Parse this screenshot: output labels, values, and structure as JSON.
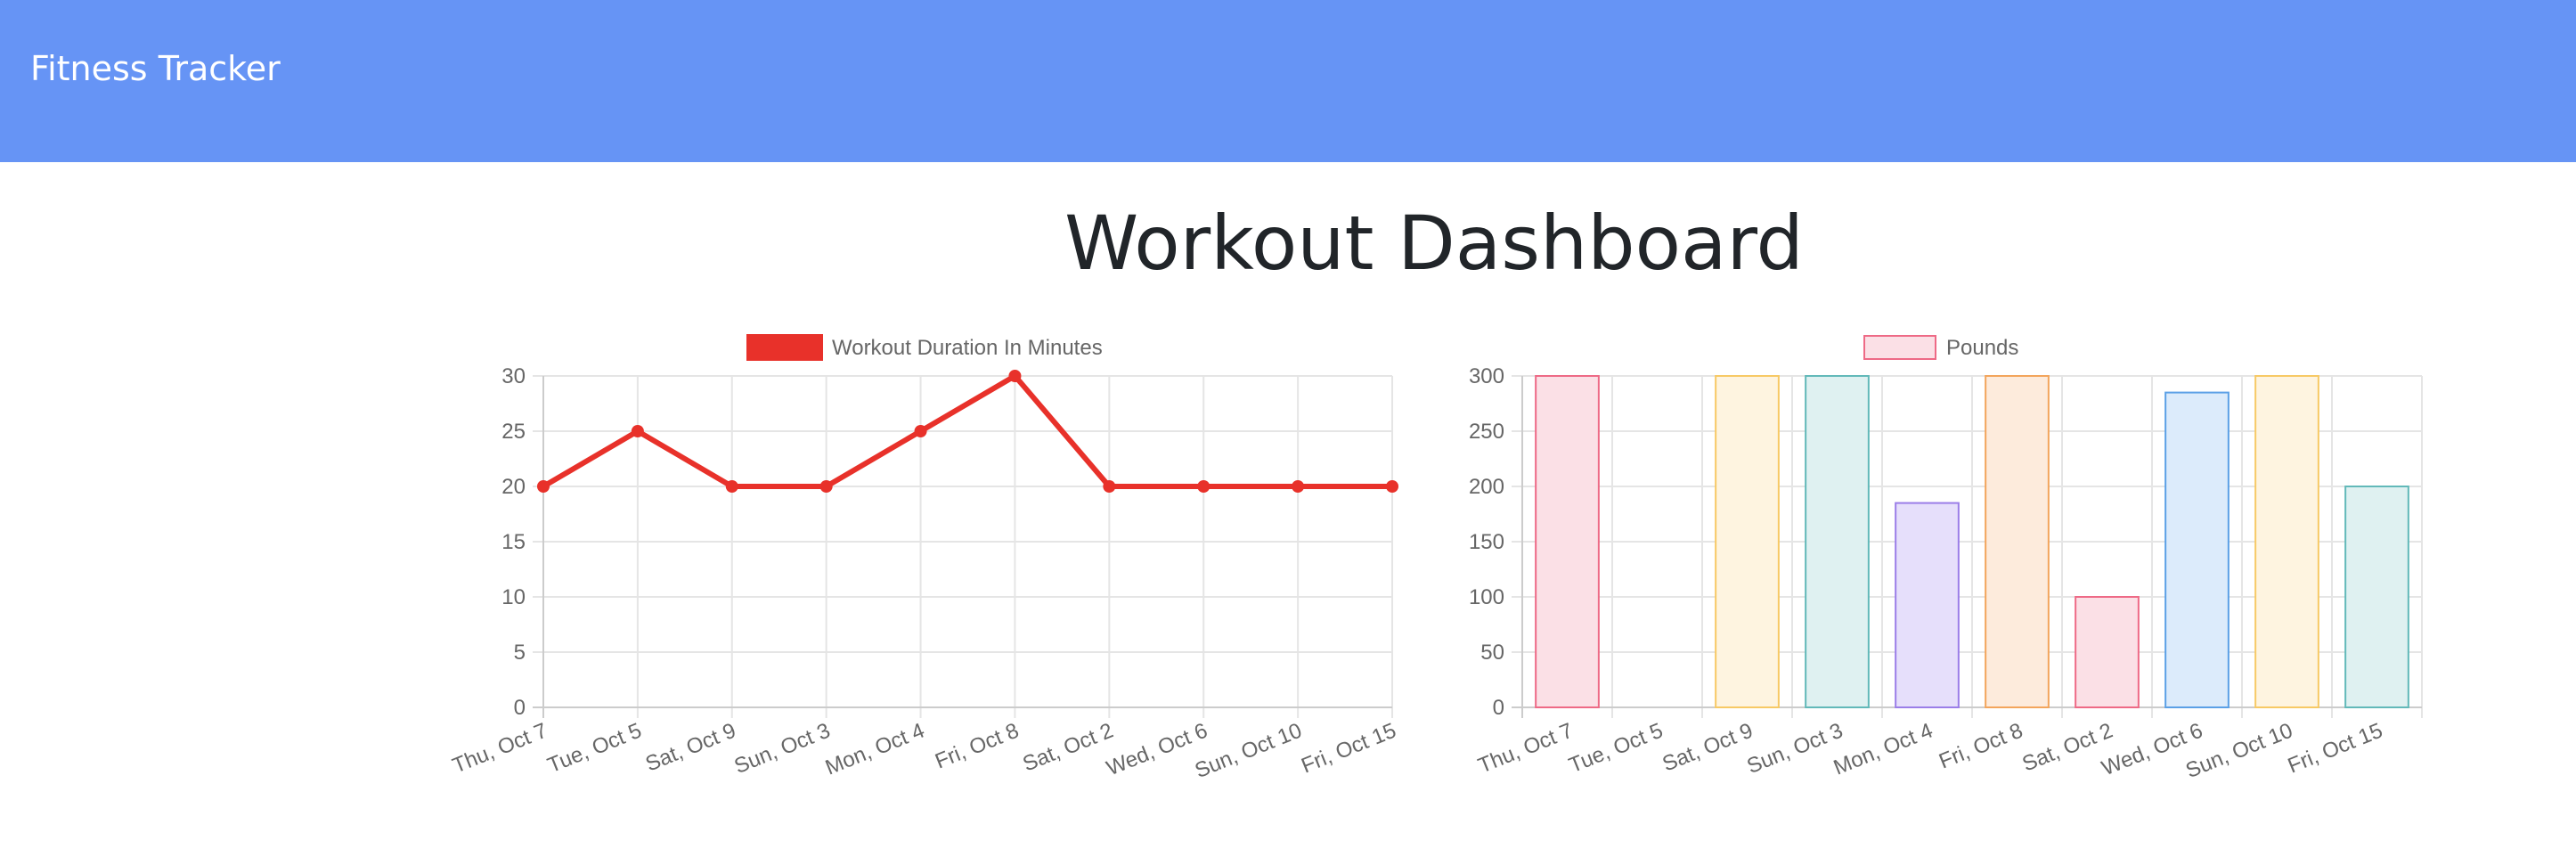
{
  "navbar": {
    "brand": "Fitness Tracker"
  },
  "page": {
    "title": "Workout Dashboard"
  },
  "colors": {
    "navbar": "#6694f5",
    "line": "#e8312a",
    "grid": "#e5e5e5",
    "axis": "#cccccc"
  },
  "chart_data": [
    {
      "type": "line",
      "legend": "Workout Duration In Minutes",
      "legend_position": "top-center",
      "grid": true,
      "categories": [
        "Thu, Oct 7",
        "Tue, Oct 5",
        "Sat, Oct 9",
        "Sun, Oct 3",
        "Mon, Oct 4",
        "Fri, Oct 8",
        "Sat, Oct 2",
        "Wed, Oct 6",
        "Sun, Oct 10",
        "Fri, Oct 15"
      ],
      "series": [
        {
          "name": "Workout Duration In Minutes",
          "values": [
            20,
            25,
            20,
            20,
            25,
            30,
            20,
            20,
            20,
            20
          ],
          "color": "#e8312a"
        }
      ],
      "ylim": [
        0,
        30
      ],
      "yticks": [
        0,
        5,
        10,
        15,
        20,
        25,
        30
      ]
    },
    {
      "type": "bar",
      "legend": "Pounds",
      "legend_position": "top-center",
      "grid": true,
      "categories": [
        "Thu, Oct 7",
        "Tue, Oct 5",
        "Sat, Oct 9",
        "Sun, Oct 3",
        "Mon, Oct 4",
        "Fri, Oct 8",
        "Sat, Oct 2",
        "Wed, Oct 6",
        "Sun, Oct 10",
        "Fri, Oct 15"
      ],
      "series": [
        {
          "name": "Pounds",
          "values": [
            300,
            0,
            300,
            300,
            185,
            300,
            100,
            285,
            300,
            200
          ],
          "fills": [
            "#fbe0e6",
            "#fbe0e6",
            "#fef4e0",
            "#dff1f1",
            "#e6dffb",
            "#fdebdc",
            "#fbe0e6",
            "#dcebfb",
            "#fef4e0",
            "#dff1f1"
          ],
          "strokes": [
            "#ee6a86",
            "#ee6a86",
            "#f7c965",
            "#62b9b9",
            "#9b7ee8",
            "#f3a55c",
            "#ee6a86",
            "#5ba0e6",
            "#f7c965",
            "#62b9b9"
          ]
        }
      ],
      "ylim": [
        0,
        300
      ],
      "yticks": [
        0,
        50,
        100,
        150,
        200,
        250,
        300
      ]
    }
  ]
}
